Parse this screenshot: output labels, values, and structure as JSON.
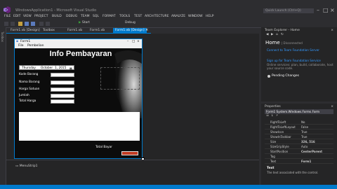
{
  "window": {
    "title": "WindowsApplication1 - Microsoft Visual Studio",
    "quick_launch": "Quick Launch (Ctrl+Q)",
    "accent": "#007acc"
  },
  "menu": [
    "FILE",
    "EDIT",
    "VIEW",
    "PROJECT",
    "BUILD",
    "DEBUG",
    "TEAM",
    "SQL",
    "FORMAT",
    "TOOLS",
    "TEST",
    "ARCHITECTURE",
    "ANALYZE",
    "WINDOW",
    "HELP"
  ],
  "toolbar": {
    "start_label": "Start",
    "config": "Debug"
  },
  "left_strip_label": "Toolbox",
  "tabs": [
    {
      "label": "Form1.vb [Design]"
    },
    {
      "label": "Form1.vb"
    },
    {
      "label": "Form1.vb"
    },
    {
      "label": "Form1.vb"
    },
    {
      "label": "Form1.vb [Design]"
    }
  ],
  "form": {
    "title": "Form1",
    "menu": [
      "File",
      "Pembelian"
    ],
    "heading": "Info Pembayaran",
    "date": {
      "day": "Thursday",
      "month": "October",
      "rest": "1, 2015"
    },
    "fields": [
      {
        "label": "Kode Barang"
      },
      {
        "label": "Nama Barang"
      },
      {
        "label": "Harga Satuan"
      },
      {
        "label": "Jumlah"
      },
      {
        "label": "Total Harga"
      }
    ],
    "total_label": "Total Bayar"
  },
  "tray": {
    "item": "MenuStrip1"
  },
  "team_explorer": {
    "header": "Team Explorer - Home",
    "home": "Home",
    "home_suffix": "| Disconnected",
    "links": [
      "Connect to Team Foundation Server",
      "Sign up for Team Foundation Service"
    ],
    "text": "Online services: plan, build, collaborate, host your source code.",
    "pending": "Pending Changes"
  },
  "properties": {
    "header": "Properties",
    "object": "Form1  System.Windows.Forms.Form",
    "rows": [
      {
        "name": "RightToLeft",
        "value": "No"
      },
      {
        "name": "RightToLeftLayout",
        "value": "False"
      },
      {
        "name": "ShowIcon",
        "value": "True"
      },
      {
        "name": "ShowInTaskbar",
        "value": "True"
      },
      {
        "name": "Size",
        "value": "326, 516"
      },
      {
        "name": "SizeGripStyle",
        "value": "Auto"
      },
      {
        "name": "StartPosition",
        "value": "CenterParent"
      },
      {
        "name": "Tag",
        "value": ""
      },
      {
        "name": "Text",
        "value": "Form1"
      }
    ],
    "desc_title": "Text",
    "desc": "The text associated with the control."
  }
}
